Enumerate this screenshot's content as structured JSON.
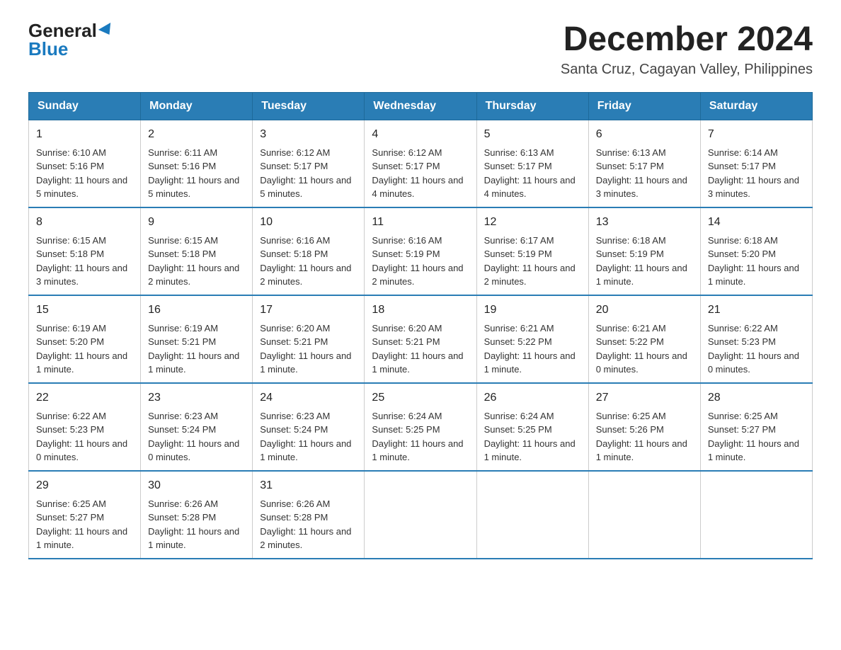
{
  "logo": {
    "general": "General",
    "blue": "Blue"
  },
  "title": "December 2024",
  "subtitle": "Santa Cruz, Cagayan Valley, Philippines",
  "days": [
    "Sunday",
    "Monday",
    "Tuesday",
    "Wednesday",
    "Thursday",
    "Friday",
    "Saturday"
  ],
  "weeks": [
    [
      {
        "day": "1",
        "sunrise": "6:10 AM",
        "sunset": "5:16 PM",
        "daylight": "11 hours and 5 minutes."
      },
      {
        "day": "2",
        "sunrise": "6:11 AM",
        "sunset": "5:16 PM",
        "daylight": "11 hours and 5 minutes."
      },
      {
        "day": "3",
        "sunrise": "6:12 AM",
        "sunset": "5:17 PM",
        "daylight": "11 hours and 5 minutes."
      },
      {
        "day": "4",
        "sunrise": "6:12 AM",
        "sunset": "5:17 PM",
        "daylight": "11 hours and 4 minutes."
      },
      {
        "day": "5",
        "sunrise": "6:13 AM",
        "sunset": "5:17 PM",
        "daylight": "11 hours and 4 minutes."
      },
      {
        "day": "6",
        "sunrise": "6:13 AM",
        "sunset": "5:17 PM",
        "daylight": "11 hours and 3 minutes."
      },
      {
        "day": "7",
        "sunrise": "6:14 AM",
        "sunset": "5:17 PM",
        "daylight": "11 hours and 3 minutes."
      }
    ],
    [
      {
        "day": "8",
        "sunrise": "6:15 AM",
        "sunset": "5:18 PM",
        "daylight": "11 hours and 3 minutes."
      },
      {
        "day": "9",
        "sunrise": "6:15 AM",
        "sunset": "5:18 PM",
        "daylight": "11 hours and 2 minutes."
      },
      {
        "day": "10",
        "sunrise": "6:16 AM",
        "sunset": "5:18 PM",
        "daylight": "11 hours and 2 minutes."
      },
      {
        "day": "11",
        "sunrise": "6:16 AM",
        "sunset": "5:19 PM",
        "daylight": "11 hours and 2 minutes."
      },
      {
        "day": "12",
        "sunrise": "6:17 AM",
        "sunset": "5:19 PM",
        "daylight": "11 hours and 2 minutes."
      },
      {
        "day": "13",
        "sunrise": "6:18 AM",
        "sunset": "5:19 PM",
        "daylight": "11 hours and 1 minute."
      },
      {
        "day": "14",
        "sunrise": "6:18 AM",
        "sunset": "5:20 PM",
        "daylight": "11 hours and 1 minute."
      }
    ],
    [
      {
        "day": "15",
        "sunrise": "6:19 AM",
        "sunset": "5:20 PM",
        "daylight": "11 hours and 1 minute."
      },
      {
        "day": "16",
        "sunrise": "6:19 AM",
        "sunset": "5:21 PM",
        "daylight": "11 hours and 1 minute."
      },
      {
        "day": "17",
        "sunrise": "6:20 AM",
        "sunset": "5:21 PM",
        "daylight": "11 hours and 1 minute."
      },
      {
        "day": "18",
        "sunrise": "6:20 AM",
        "sunset": "5:21 PM",
        "daylight": "11 hours and 1 minute."
      },
      {
        "day": "19",
        "sunrise": "6:21 AM",
        "sunset": "5:22 PM",
        "daylight": "11 hours and 1 minute."
      },
      {
        "day": "20",
        "sunrise": "6:21 AM",
        "sunset": "5:22 PM",
        "daylight": "11 hours and 0 minutes."
      },
      {
        "day": "21",
        "sunrise": "6:22 AM",
        "sunset": "5:23 PM",
        "daylight": "11 hours and 0 minutes."
      }
    ],
    [
      {
        "day": "22",
        "sunrise": "6:22 AM",
        "sunset": "5:23 PM",
        "daylight": "11 hours and 0 minutes."
      },
      {
        "day": "23",
        "sunrise": "6:23 AM",
        "sunset": "5:24 PM",
        "daylight": "11 hours and 0 minutes."
      },
      {
        "day": "24",
        "sunrise": "6:23 AM",
        "sunset": "5:24 PM",
        "daylight": "11 hours and 1 minute."
      },
      {
        "day": "25",
        "sunrise": "6:24 AM",
        "sunset": "5:25 PM",
        "daylight": "11 hours and 1 minute."
      },
      {
        "day": "26",
        "sunrise": "6:24 AM",
        "sunset": "5:25 PM",
        "daylight": "11 hours and 1 minute."
      },
      {
        "day": "27",
        "sunrise": "6:25 AM",
        "sunset": "5:26 PM",
        "daylight": "11 hours and 1 minute."
      },
      {
        "day": "28",
        "sunrise": "6:25 AM",
        "sunset": "5:27 PM",
        "daylight": "11 hours and 1 minute."
      }
    ],
    [
      {
        "day": "29",
        "sunrise": "6:25 AM",
        "sunset": "5:27 PM",
        "daylight": "11 hours and 1 minute."
      },
      {
        "day": "30",
        "sunrise": "6:26 AM",
        "sunset": "5:28 PM",
        "daylight": "11 hours and 1 minute."
      },
      {
        "day": "31",
        "sunrise": "6:26 AM",
        "sunset": "5:28 PM",
        "daylight": "11 hours and 2 minutes."
      },
      null,
      null,
      null,
      null
    ]
  ]
}
